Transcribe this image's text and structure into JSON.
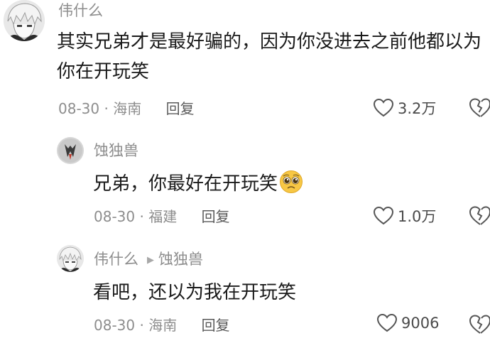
{
  "comments": [
    {
      "author": "伟什么",
      "text": "其实兄弟才是最好骗的，因为你没进去之前他都以为你在开玩笑",
      "date": "08-30",
      "location": "海南",
      "reply_label": "回复",
      "likes": "3.2万",
      "icons": {
        "like": "heart-outline-icon",
        "dislike": "broken-heart-icon"
      }
    },
    {
      "author": "蚀独兽",
      "text": "兄弟，你最好在开玩笑",
      "emoji": "pleading-face-emoji",
      "date": "08-30",
      "location": "福建",
      "reply_label": "回复",
      "likes": "1.0万"
    },
    {
      "author": "伟什么",
      "reply_to": "蚀独兽",
      "text": "看吧，还以为我在开玩笑",
      "date": "08-30",
      "location": "海南",
      "reply_label": "回复",
      "likes": "9006"
    }
  ],
  "meta_separator": "·",
  "colors": {
    "meta": "#8d8d8d",
    "text": "#1a1a1a",
    "icon": "#555555"
  }
}
